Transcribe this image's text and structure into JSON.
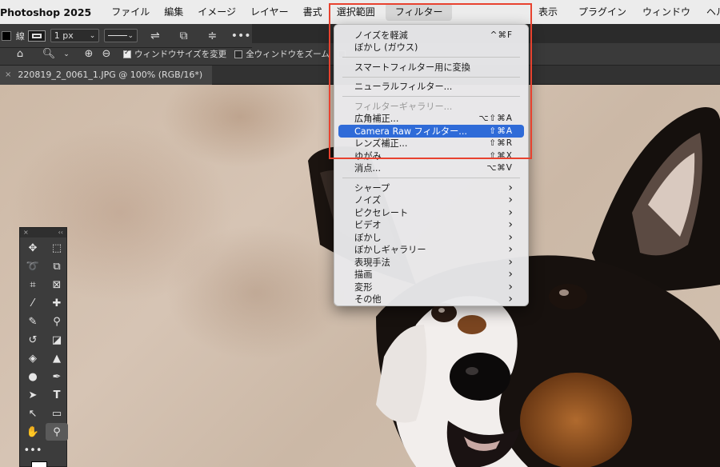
{
  "menubar": {
    "app": "Photoshop 2025",
    "items": [
      "ファイル",
      "編集",
      "イメージ",
      "レイヤー",
      "書式",
      "選択範囲",
      "フィルター"
    ],
    "right_items": [
      "表示",
      "プラグイン",
      "ウィンドウ",
      "ヘルプ"
    ],
    "active": "フィルター"
  },
  "options": {
    "stroke_label": "線",
    "stroke_width": "1 px",
    "resize_window": "ウィンドウサイズを変更",
    "zoom_all": "全ウィンドウをズーム"
  },
  "document": {
    "tab_title": "220819_2_0061_1.JPG @ 100% (RGB/16*)",
    "close": "×"
  },
  "filter_menu": {
    "items": [
      {
        "label": "ノイズを軽減",
        "shortcut": "^⌘F"
      },
      {
        "label": "ぼかし (ガウス)",
        "shortcut": ""
      },
      {
        "sep": true
      },
      {
        "label": "スマートフィルター用に変換",
        "shortcut": ""
      },
      {
        "sep": true
      },
      {
        "label": "ニューラルフィルター...",
        "shortcut": ""
      },
      {
        "sep": true
      },
      {
        "label": "フィルターギャラリー...",
        "shortcut": "",
        "disabled": true
      },
      {
        "label": "広角補正...",
        "shortcut": "⌥⇧⌘A"
      },
      {
        "label": "Camera Raw フィルター...",
        "shortcut": "⇧⌘A",
        "highlighted": true
      },
      {
        "label": "レンズ補正...",
        "shortcut": "⇧⌘R"
      },
      {
        "label": "ゆがみ...",
        "shortcut": "⇧⌘X"
      },
      {
        "label": "消点...",
        "shortcut": "⌥⌘V"
      },
      {
        "sep": true
      },
      {
        "label": "シャープ",
        "submenu": true
      },
      {
        "label": "ノイズ",
        "submenu": true
      },
      {
        "label": "ピクセレート",
        "submenu": true
      },
      {
        "label": "ビデオ",
        "submenu": true
      },
      {
        "label": "ぼかし",
        "submenu": true
      },
      {
        "label": "ぼかしギャラリー",
        "submenu": true
      },
      {
        "label": "表現手法",
        "submenu": true
      },
      {
        "label": "描画",
        "submenu": true
      },
      {
        "label": "変形",
        "submenu": true
      },
      {
        "label": "その他",
        "submenu": true
      }
    ]
  },
  "colors": {
    "highlight": "#2f6bd8",
    "annotation": "#e8422f"
  }
}
